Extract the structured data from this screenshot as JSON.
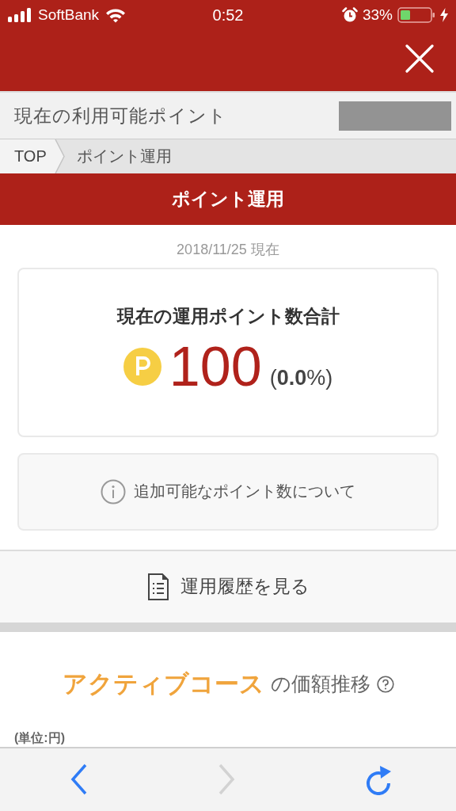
{
  "status_bar": {
    "carrier": "SoftBank",
    "time": "0:52",
    "battery": "33%"
  },
  "available_points": {
    "label": "現在の利用可能ポイント"
  },
  "breadcrumbs": [
    {
      "label": "TOP"
    },
    {
      "label": "ポイント運用"
    }
  ],
  "page_title": "ポイント運用",
  "as_of": "2018/11/25 現在",
  "summary": {
    "title": "現在の運用ポイント数合計",
    "points": "100",
    "change": "(**0.0**%)"
  },
  "info_link": "追加可能なポイント数について",
  "history_button": "運用履歴を見る",
  "course": {
    "name": "アクティブコース",
    "suffix": "の価額推移"
  },
  "unit": "(単位:円)",
  "toolbar": [
    {
      "kind": "back",
      "disabled": false
    },
    {
      "kind": "forward",
      "disabled": true
    },
    {
      "kind": "reload",
      "disabled": false
    }
  ]
}
